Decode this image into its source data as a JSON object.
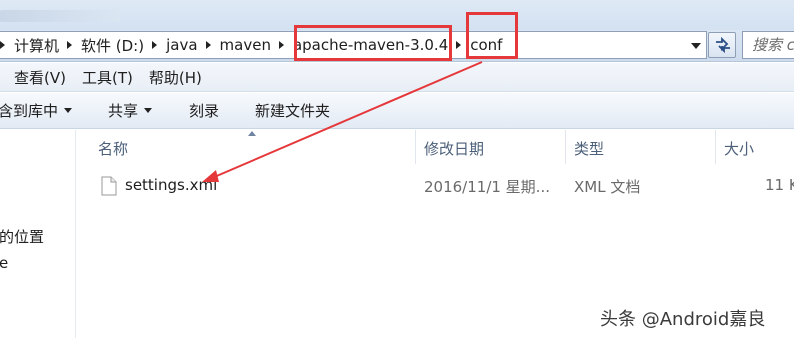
{
  "address_bar": {
    "breadcrumbs": [
      "计算机",
      "软件 (D:)",
      "java",
      "maven",
      "apache-maven-3.0.4",
      "conf"
    ]
  },
  "search": {
    "placeholder": "搜索 c"
  },
  "menu": {
    "items": [
      "查看(V)",
      "工具(T)",
      "帮助(H)"
    ]
  },
  "toolbar": {
    "include_library": "含到库中",
    "share": "共享",
    "burn": "刻录",
    "new_folder": "新建文件夹"
  },
  "navigation": {
    "items": [
      "的位置",
      "e"
    ]
  },
  "file_list": {
    "columns": [
      "名称",
      "修改日期",
      "类型",
      "大小"
    ],
    "rows": [
      {
        "name": "settings.xml",
        "modified": "2016/11/1 星期...",
        "type": "XML 文档",
        "size": "11 K"
      }
    ]
  },
  "watermark": "头条 @Android嘉良",
  "colors": {
    "annotation": "#e5383b",
    "address_bar_bg": "#d3e1f1"
  },
  "icons": {
    "refresh": "refresh-icon",
    "file": "xml-file-icon",
    "dropdown": "chevron-down-icon"
  }
}
